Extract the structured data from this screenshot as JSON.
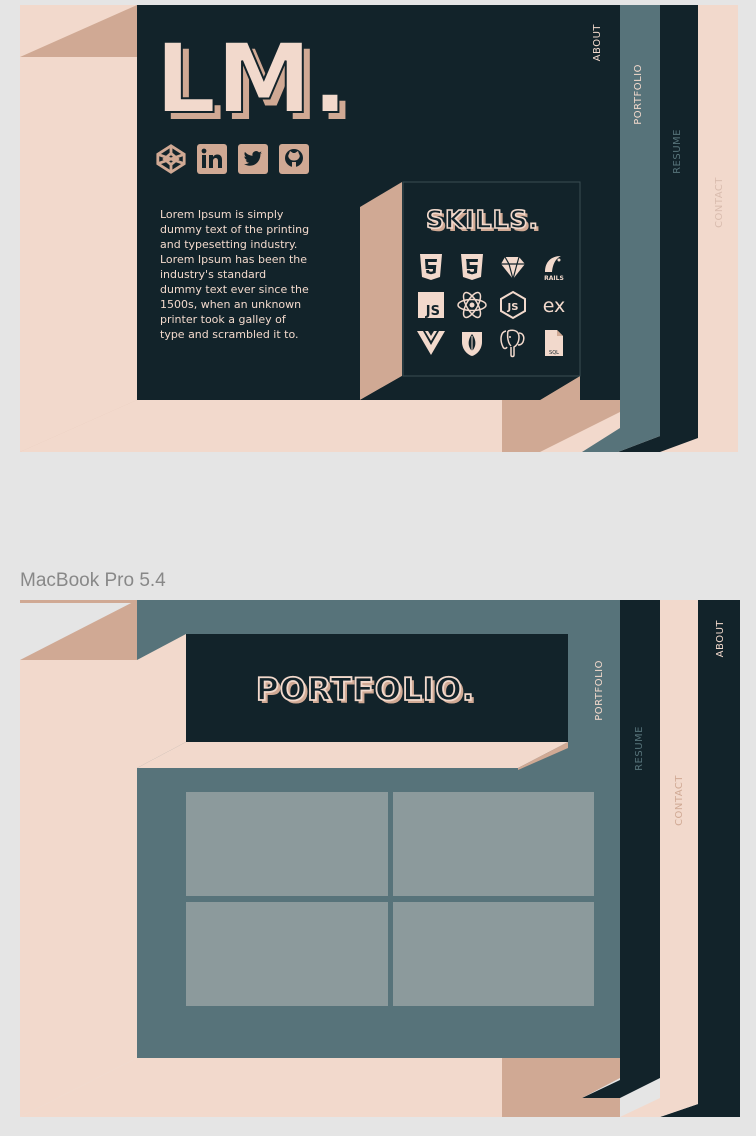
{
  "frame1": {
    "logo": "LM.",
    "social_icons": [
      "codepen-icon",
      "linkedin-icon",
      "twitter-icon",
      "github-icon"
    ],
    "about_text": "Lorem Ipsum is simply dummy text of the printing and typesetting industry. Lorem Ipsum has been the industry's standard dummy text ever since the 1500s, when an unknown printer took a galley of type and scrambled it to.",
    "skills_title": "SKILLS.",
    "skills_icons": [
      "html5-icon",
      "css3-icon",
      "ruby-icon",
      "rails-icon",
      "javascript-icon",
      "react-icon",
      "nodejs-icon",
      "express-icon",
      "vue-icon",
      "mongodb-icon",
      "postgresql-icon",
      "sql-file-icon"
    ],
    "express_label": "ex",
    "rails_label": "RAILS",
    "js_label": "JS",
    "sql_label": "SQL",
    "tabs": [
      "ABOUT",
      "PORTFOLIO",
      "RESUME",
      "CONTACT"
    ]
  },
  "frame2": {
    "frame_label": "MacBook Pro 5.4",
    "title": "PORTFOLIO.",
    "tabs": [
      "PORTFOLIO",
      "RESUME",
      "CONTACT",
      "ABOUT"
    ],
    "thumbnail_count": 4
  },
  "colors": {
    "background": "#e5e5e5",
    "dark": "#12232a",
    "teal": "#57737a",
    "peach": "#f2d9cc",
    "tan": "#d0a994",
    "thumb": "#8c9a9c"
  }
}
